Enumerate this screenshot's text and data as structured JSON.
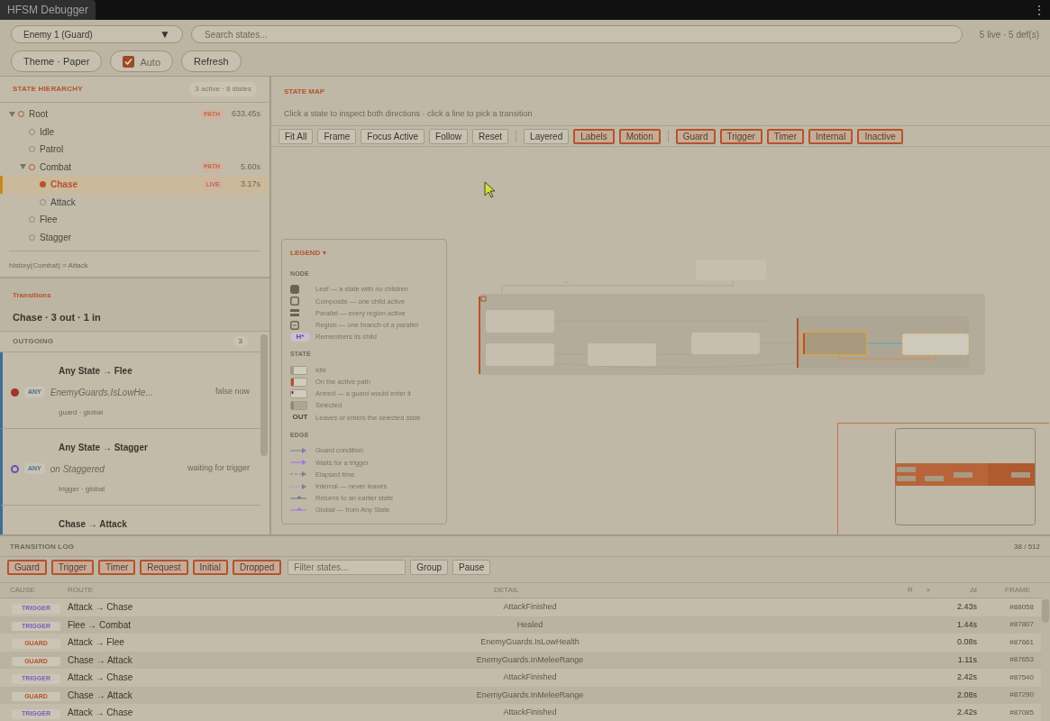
{
  "window": {
    "title": "HFSM Debugger",
    "menu": "⋮"
  },
  "toolbar": {
    "entity": "Enemy 1 (Guard)",
    "dropdown_arrow": "▼",
    "search_placeholder": "Search states...",
    "summary": "5 live · 5 def(s)",
    "theme_button": "Theme · Paper",
    "auto": {
      "label": "Auto",
      "checked": true
    },
    "refresh_button": "Refresh"
  },
  "hierarchy": {
    "title": "STATE HIERARCHY",
    "badge": "3 active · 8 states",
    "history": "history(Combat) = Attack",
    "tree": [
      {
        "label": "Root",
        "kind": "path",
        "expanded": true,
        "tag": "PATH",
        "time": "633.45s",
        "selected": false,
        "children": [
          {
            "label": "Idle",
            "kind": "idle",
            "selected": false
          },
          {
            "label": "Patrol",
            "kind": "idle",
            "selected": false
          },
          {
            "label": "Combat",
            "kind": "path",
            "expanded": true,
            "tag": "PATH",
            "time": "5.60s",
            "selected": false,
            "children": [
              {
                "label": "Chase",
                "kind": "live",
                "tag": "LIVE",
                "time": "3.17s",
                "selected": true
              },
              {
                "label": "Attack",
                "kind": "idle",
                "selected": false
              }
            ]
          },
          {
            "label": "Flee",
            "kind": "idle",
            "selected": false
          },
          {
            "label": "Stagger",
            "kind": "idle",
            "selected": false
          }
        ]
      }
    ]
  },
  "transitions": {
    "title": "Transitions",
    "summary": "Chase · 3 out · 1 in",
    "outgoing": {
      "title": "OUTGOING",
      "count": "3",
      "items": [
        {
          "kind": "guard",
          "route": "Any State → Flee",
          "badge": "ANY",
          "condition": "EnemyGuards.IsLowHe...",
          "status": "false now",
          "meta": "guard · global"
        },
        {
          "kind": "trigger",
          "route": "Any State → Stagger",
          "badge": "ANY",
          "condition": "on Staggered",
          "status": "waiting for trigger",
          "meta": "trigger · global"
        },
        {
          "route": "Chase → Attack"
        }
      ]
    }
  },
  "state_map": {
    "title": "STATE MAP",
    "hint": "Click a state to inspect both directions · click a line to pick a transition",
    "control_groups": [
      [
        {
          "label": "Fit All",
          "on": false
        },
        {
          "label": "Frame",
          "on": false
        },
        {
          "label": "Focus Active",
          "on": false
        },
        {
          "label": "Follow",
          "on": false
        },
        {
          "label": "Reset",
          "on": false
        }
      ],
      [
        {
          "label": "Layered",
          "on": false
        },
        {
          "label": "Labels",
          "on": true
        },
        {
          "label": "Motion",
          "on": true
        }
      ],
      [
        {
          "label": "Guard",
          "on": true
        },
        {
          "label": "Trigger",
          "on": true
        },
        {
          "label": "Timer",
          "on": true
        },
        {
          "label": "Internal",
          "on": true
        },
        {
          "label": "Inactive",
          "on": true
        }
      ]
    ],
    "legend": {
      "title": "LEGEND",
      "caret": "▾",
      "sections": [
        {
          "title": "NODE",
          "items": [
            {
              "kind": "leaf",
              "label": "Leaf — a state with no children"
            },
            {
              "kind": "composite",
              "label": "Composite — one child active"
            },
            {
              "kind": "parallel",
              "label": "Parallel — every region active"
            },
            {
              "kind": "region",
              "label": "Region — one branch of a parallel"
            },
            {
              "kind": "history",
              "symbol": "H*",
              "label": "Remembers its child"
            }
          ]
        },
        {
          "title": "STATE",
          "items": [
            {
              "kind": "idle",
              "label": "Idle"
            },
            {
              "kind": "active",
              "label": "On the active path"
            },
            {
              "kind": "armed",
              "label": "Armed — a guard would enter it"
            },
            {
              "kind": "selected",
              "label": "Selected"
            },
            {
              "kind": "out",
              "symbol": "OUT",
              "label": "Leaves or enters the selected state"
            }
          ]
        },
        {
          "title": "EDGE",
          "items": [
            {
              "kind": "guard",
              "label": "Guard condition"
            },
            {
              "kind": "trigger",
              "label": "Waits for a trigger"
            },
            {
              "kind": "timer",
              "label": "Elapsed time"
            },
            {
              "kind": "internal",
              "label": "Internal — never leaves"
            },
            {
              "kind": "return",
              "label": "Returns to an earlier state"
            },
            {
              "kind": "global",
              "label": "Global — from Any State"
            }
          ]
        }
      ]
    }
  },
  "log": {
    "title": "TRANSITION LOG",
    "count": "38 / 512",
    "filters": [
      {
        "label": "Guard",
        "on": true
      },
      {
        "label": "Trigger",
        "on": true
      },
      {
        "label": "Timer",
        "on": true
      },
      {
        "label": "Request",
        "on": true
      },
      {
        "label": "Initial",
        "on": true
      },
      {
        "label": "Dropped",
        "on": true
      }
    ],
    "filter_placeholder": "Filter states...",
    "buttons": [
      "Group",
      "Pause"
    ],
    "columns": [
      "CAUSE",
      "ROUTE",
      "DETAIL",
      "R",
      "×",
      "Δt",
      "FRAME"
    ],
    "rows": [
      {
        "kind": "trigger",
        "cause": "TRIGGER",
        "route": "Attack → Chase",
        "detail": "AttackFinished",
        "dt": "2.43s",
        "frame": "#88058"
      },
      {
        "kind": "trigger",
        "cause": "TRIGGER",
        "route": "Flee → Combat",
        "detail": "Healed",
        "dt": "1.44s",
        "frame": "#87807"
      },
      {
        "kind": "guard",
        "cause": "GUARD",
        "route": "Attack → Flee",
        "detail": "EnemyGuards.IsLowHealth",
        "dt": "0.08s",
        "frame": "#87661"
      },
      {
        "kind": "guard",
        "cause": "GUARD",
        "route": "Chase → Attack",
        "detail": "EnemyGuards.InMeleeRange",
        "dt": "1.11s",
        "frame": "#87653"
      },
      {
        "kind": "trigger",
        "cause": "TRIGGER",
        "route": "Attack → Chase",
        "detail": "AttackFinished",
        "dt": "2.42s",
        "frame": "#87540"
      },
      {
        "kind": "guard",
        "cause": "GUARD",
        "route": "Chase → Attack",
        "detail": "EnemyGuards.InMeleeRange",
        "dt": "2.08s",
        "frame": "#87290"
      },
      {
        "kind": "trigger",
        "cause": "TRIGGER",
        "route": "Attack → Chase",
        "detail": "AttackFinished",
        "dt": "2.42s",
        "frame": "#87085"
      }
    ]
  }
}
